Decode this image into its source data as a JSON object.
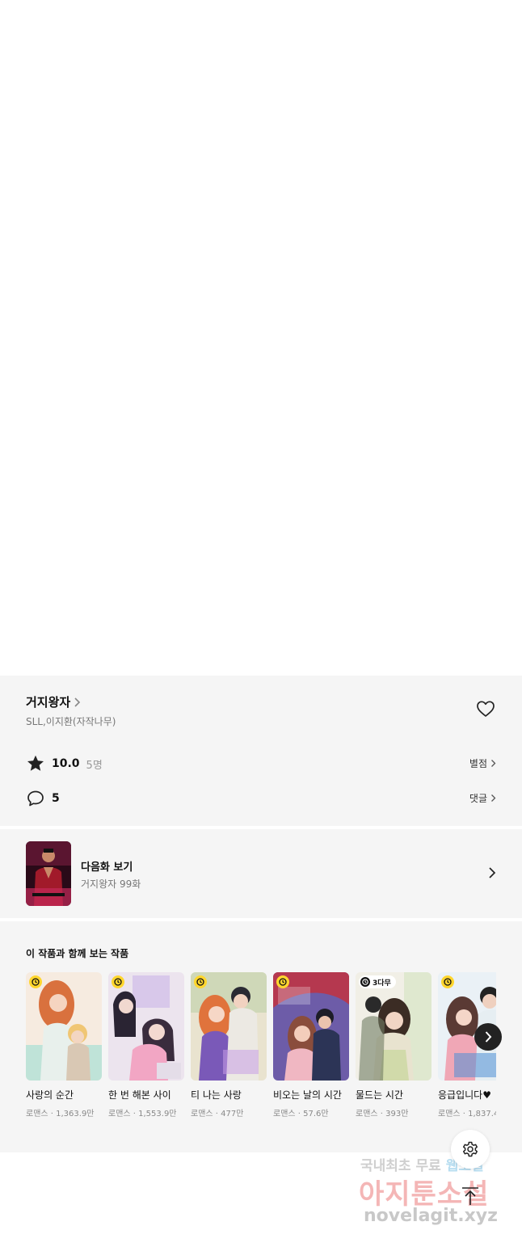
{
  "work": {
    "title": "거지왕자",
    "authors": "SLL,이지환(자작나무)"
  },
  "rating": {
    "score": "10.0",
    "count": "5명",
    "link_label": "별점"
  },
  "comments": {
    "count": "5",
    "link_label": "댓글"
  },
  "next_episode": {
    "label": "다음화 보기",
    "subtitle": "거지왕자 99화"
  },
  "recommendations": {
    "heading": "이 작품과 함께 보는 작품",
    "items": [
      {
        "title": "사랑의 순간",
        "meta": "로맨스 · 1,363.9만",
        "badge": ""
      },
      {
        "title": "한 번 해본 사이",
        "meta": "로맨스 · 1,553.9만",
        "badge": ""
      },
      {
        "title": "티 나는 사랑",
        "meta": "로맨스 · 477만",
        "badge": ""
      },
      {
        "title": "비오는 날의 시간",
        "meta": "로맨스 · 57.6만",
        "badge": ""
      },
      {
        "title": "물드는 시간",
        "meta": "로맨스 · 393만",
        "badge": "3다무"
      },
      {
        "title": "응급입니다♥",
        "meta": "로맨스 · 1,837.4",
        "badge": ""
      }
    ]
  },
  "watermark": {
    "line1a": "국내최초 무료 ",
    "line1b": "웹소설",
    "line2": "아지툰소설",
    "line3": "novelagit.xyz"
  },
  "colors": {
    "panel_bg": "#f5f5f5",
    "clock_badge": "#ffd62e",
    "text_primary": "#111111",
    "text_secondary": "#777777"
  },
  "icons": {
    "heart": "heart-outline-icon",
    "rating": "star-icon",
    "comments": "speech-bubble-icon",
    "settings": "gear-icon",
    "scroll_top": "arrow-up-to-top-icon"
  }
}
